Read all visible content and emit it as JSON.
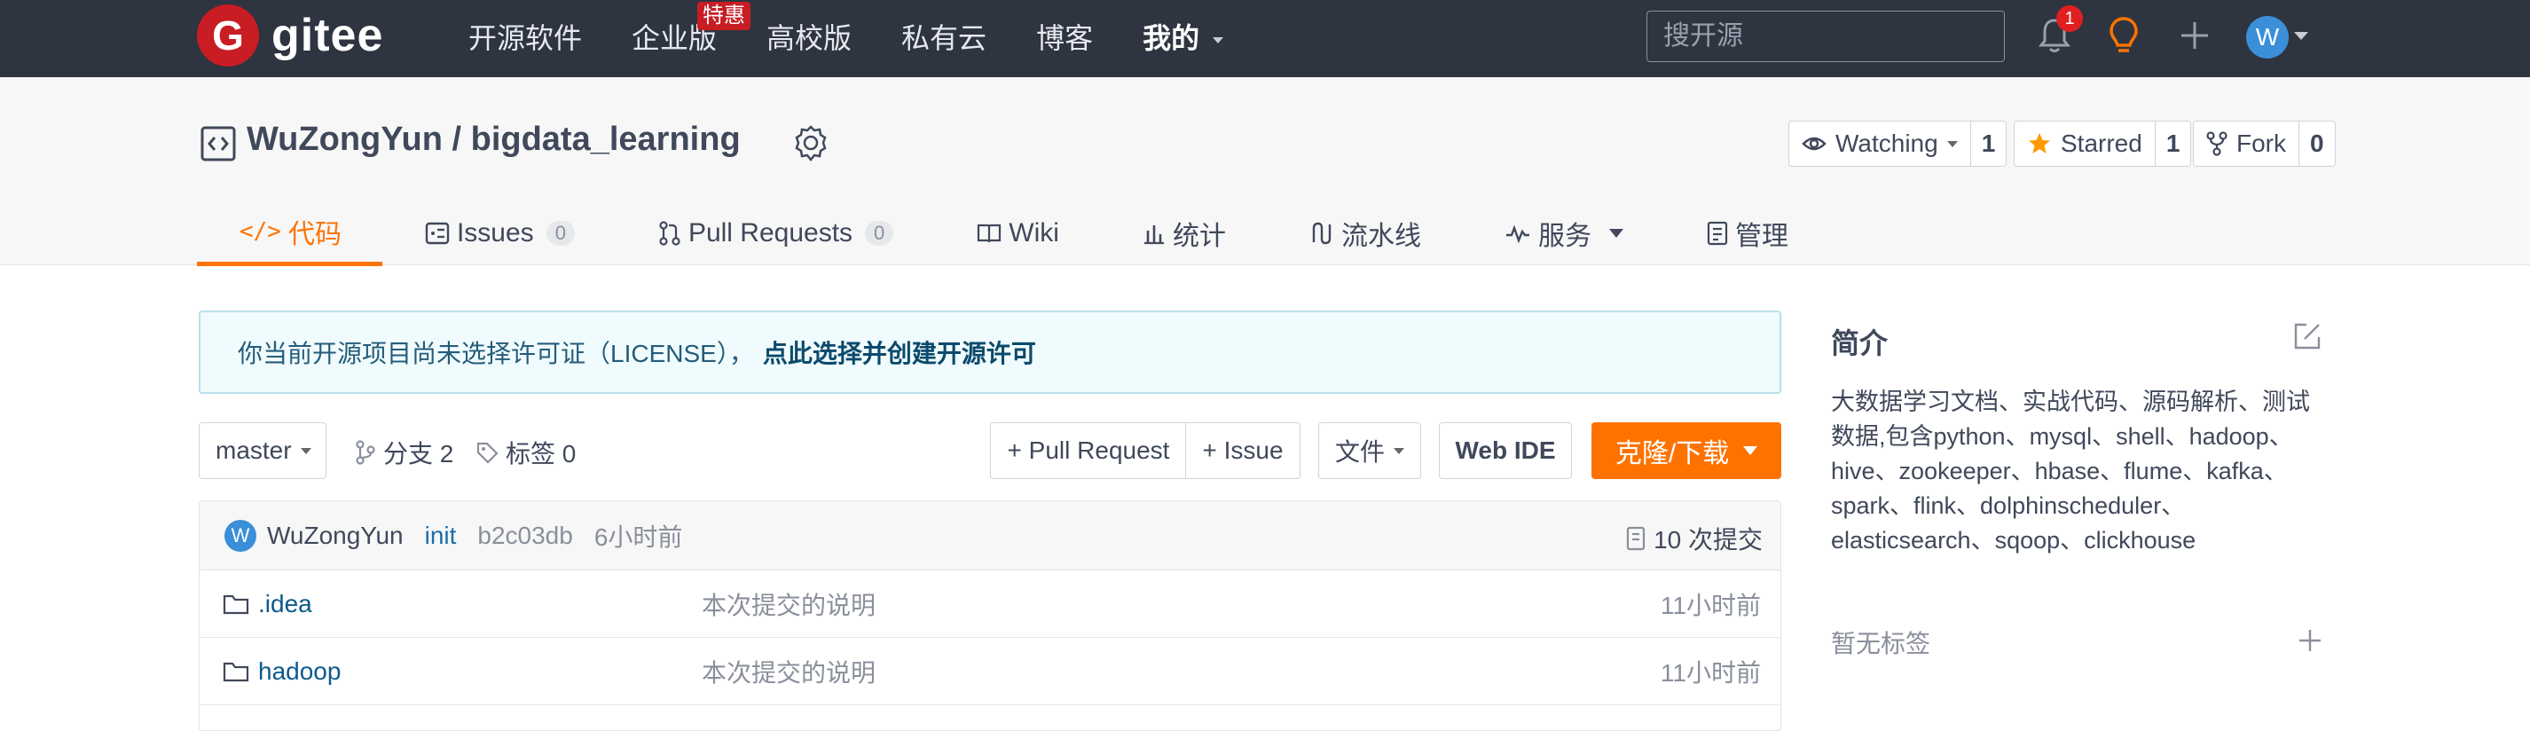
{
  "topbar": {
    "logo_text": "gitee",
    "nav": [
      "开源软件",
      "企业版",
      "高校版",
      "私有云",
      "博客"
    ],
    "nav_mine": "我的",
    "hot_badge": "特惠",
    "search_placeholder": "搜开源",
    "notification_count": "1",
    "avatar_initial": "W"
  },
  "repo": {
    "owner": "WuZongYun",
    "separator": " / ",
    "name": "bigdata_learning",
    "watch_label": "Watching",
    "watch_count": "1",
    "star_label": "Starred",
    "star_count": "1",
    "fork_label": "Fork",
    "fork_count": "0"
  },
  "tabs": [
    {
      "label": "代码",
      "icon": "code-icon"
    },
    {
      "label": "Issues",
      "count": "0",
      "icon": "issues-icon"
    },
    {
      "label": "Pull Requests",
      "count": "0",
      "icon": "pull-request-icon"
    },
    {
      "label": "Wiki",
      "icon": "wiki-icon"
    },
    {
      "label": "统计",
      "icon": "stats-icon"
    },
    {
      "label": "流水线",
      "icon": "pipeline-icon"
    },
    {
      "label": "服务",
      "icon": "service-icon"
    },
    {
      "label": "管理",
      "icon": "manage-icon"
    }
  ],
  "license_notice": {
    "text": "你当前开源项目尚未选择许可证（LICENSE），",
    "link": "点此选择并创建开源许可"
  },
  "toolbar": {
    "branch": "master",
    "branches": "分支 2",
    "tags": "标签 0",
    "pull_request": "+ Pull Request",
    "issue": "+ Issue",
    "file": "文件",
    "web_ide": "Web IDE",
    "clone": "克隆/下载"
  },
  "commit": {
    "avatar_initial": "W",
    "author": "WuZongYun",
    "message": "init",
    "hash": "b2c03db",
    "time": "6小时前",
    "count": "10 次提交"
  },
  "files": [
    {
      "name": ".idea",
      "message": "本次提交的说明",
      "time": "11小时前"
    },
    {
      "name": "hadoop",
      "message": "本次提交的说明",
      "time": "11小时前"
    }
  ],
  "sidebar": {
    "title": "简介",
    "description": "大数据学习文档、实战代码、源码解析、测试数据,包含python、mysql、shell、hadoop、hive、zookeeper、hbase、flume、kafka、spark、flink、dolphinscheduler、elasticsearch、sqoop、clickhouse",
    "no_tags": "暂无标签"
  },
  "colors": {
    "accent": "#fe7300",
    "topbar": "#2e3440",
    "brand_red": "#c71d23"
  }
}
